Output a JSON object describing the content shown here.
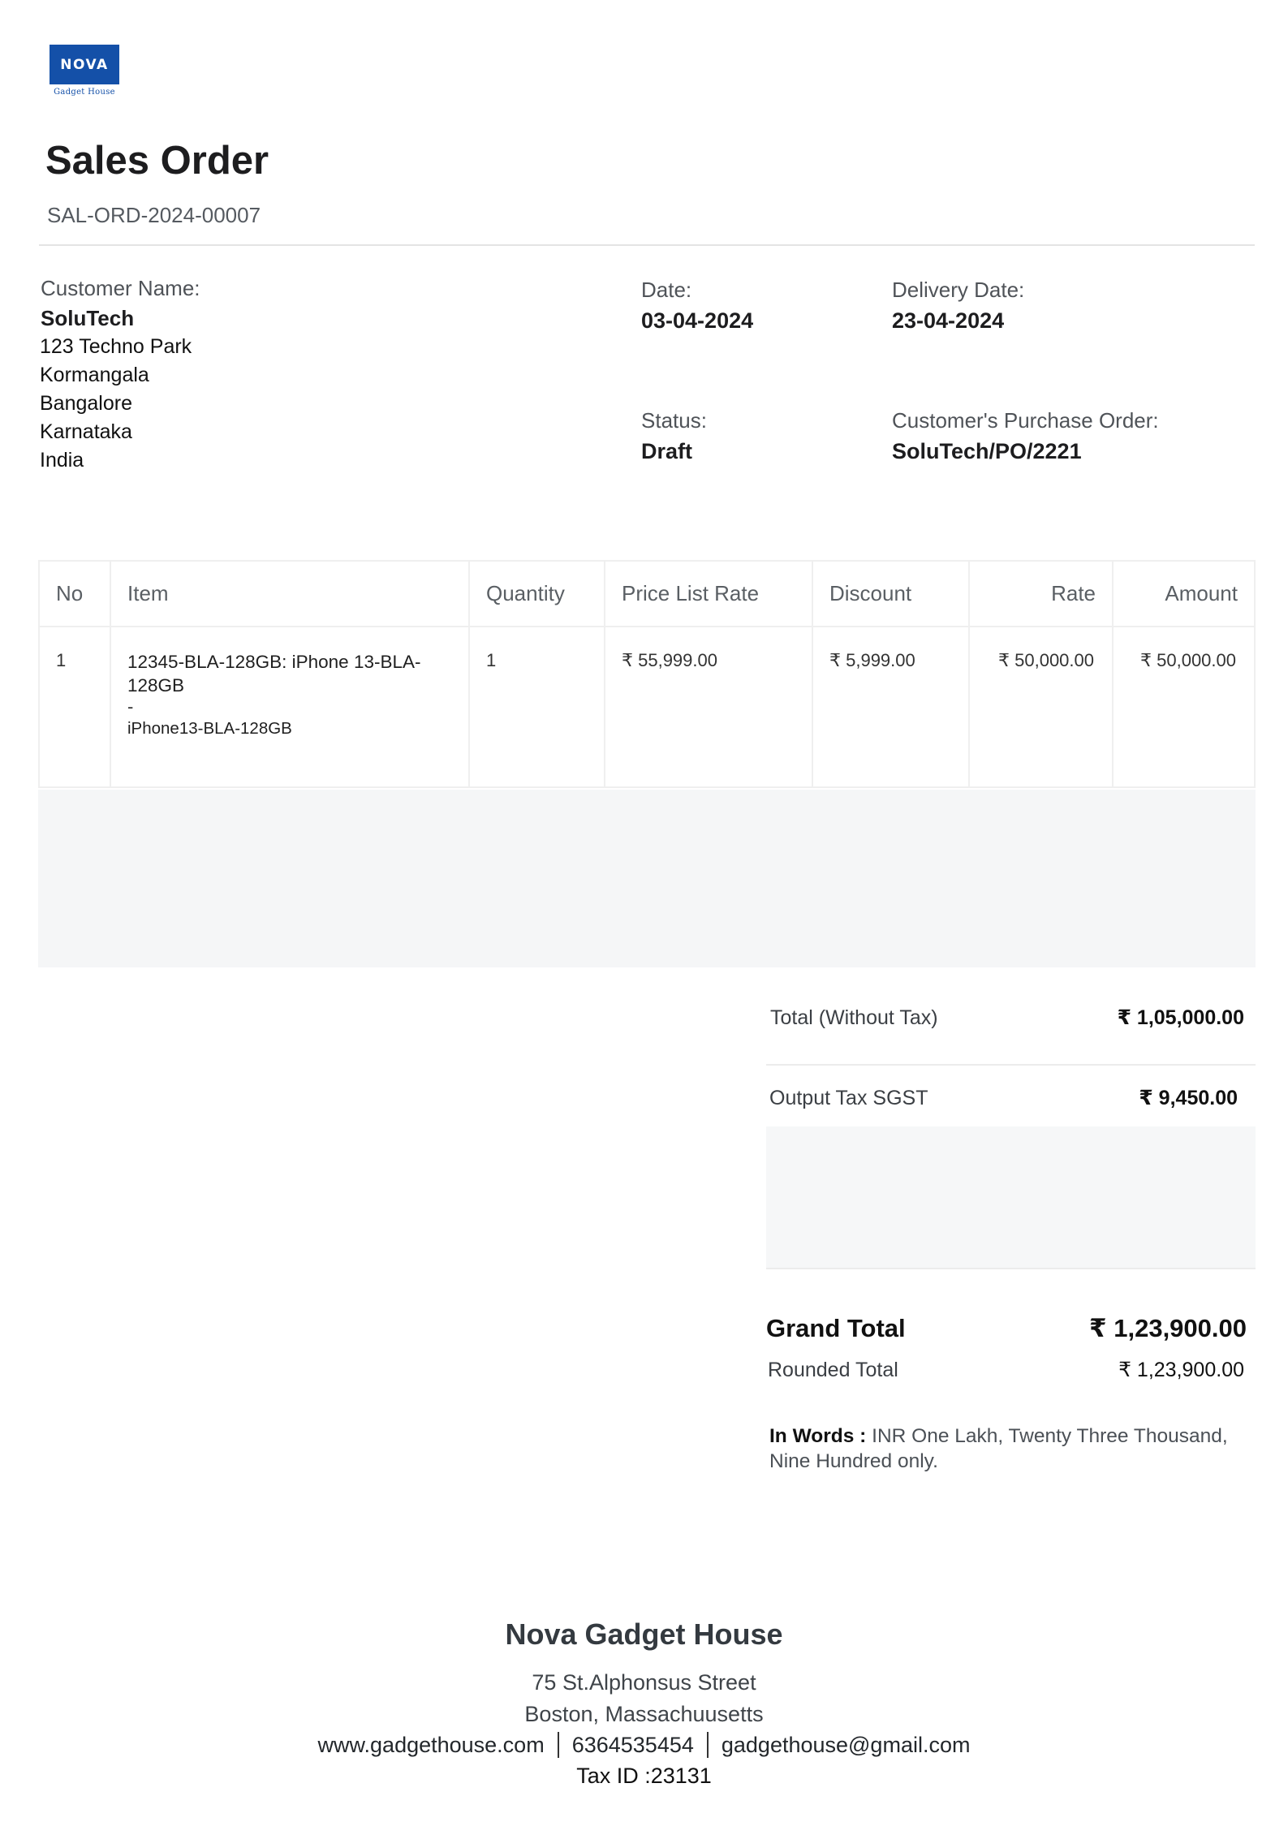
{
  "logo": {
    "brand": "NOVA",
    "tagline": "Gadget House"
  },
  "header": {
    "title": "Sales Order",
    "number": "SAL-ORD-2024-00007"
  },
  "customer": {
    "label": "Customer Name:",
    "name": "SoluTech",
    "address": [
      "123 Techno Park",
      "Kormangala",
      "Bangalore",
      "Karnataka",
      "India"
    ]
  },
  "meta": {
    "date_label": "Date:",
    "date": "03-04-2024",
    "delivery_label": "Delivery Date:",
    "delivery": "23-04-2024",
    "status_label": "Status:",
    "status": "Draft",
    "po_label": "Customer's Purchase Order:",
    "po": "SoluTech/PO/2221"
  },
  "table": {
    "headers": {
      "no": "No",
      "item": "Item",
      "qty": "Quantity",
      "plr": "Price List Rate",
      "disc": "Discount",
      "rate": "Rate",
      "amount": "Amount"
    },
    "rows": [
      {
        "no": "1",
        "item_name": "12345-BLA-128GB: iPhone 13-BLA-128GB",
        "item_sep": "-",
        "item_desc": "iPhone13-BLA-128GB",
        "qty": "1",
        "plr": "₹ 55,999.00",
        "disc": "₹ 5,999.00",
        "rate": "₹ 50,000.00",
        "amount": "₹ 50,000.00"
      }
    ]
  },
  "totals": {
    "net_label": "Total (Without Tax)",
    "net_value": "₹ 1,05,000.00",
    "tax_label": "Output Tax SGST",
    "tax_value": "₹ 9,450.00",
    "grand_label": "Grand Total",
    "grand_value": "₹ 1,23,900.00",
    "rounded_label": "Rounded Total",
    "rounded_value": "₹ 1,23,900.00",
    "words_label": "In Words :",
    "words_value": "INR One Lakh, Twenty Three Thousand, Nine Hundred only."
  },
  "footer": {
    "company": "Nova Gadget House",
    "street": "75 St.Alphonsus Street",
    "city": "Boston, Massachuusetts",
    "website": "www.gadgethouse.com",
    "phone": "6364535454",
    "email": "gadgethouse@gmail.com",
    "tax_id": "Tax ID :23131"
  }
}
